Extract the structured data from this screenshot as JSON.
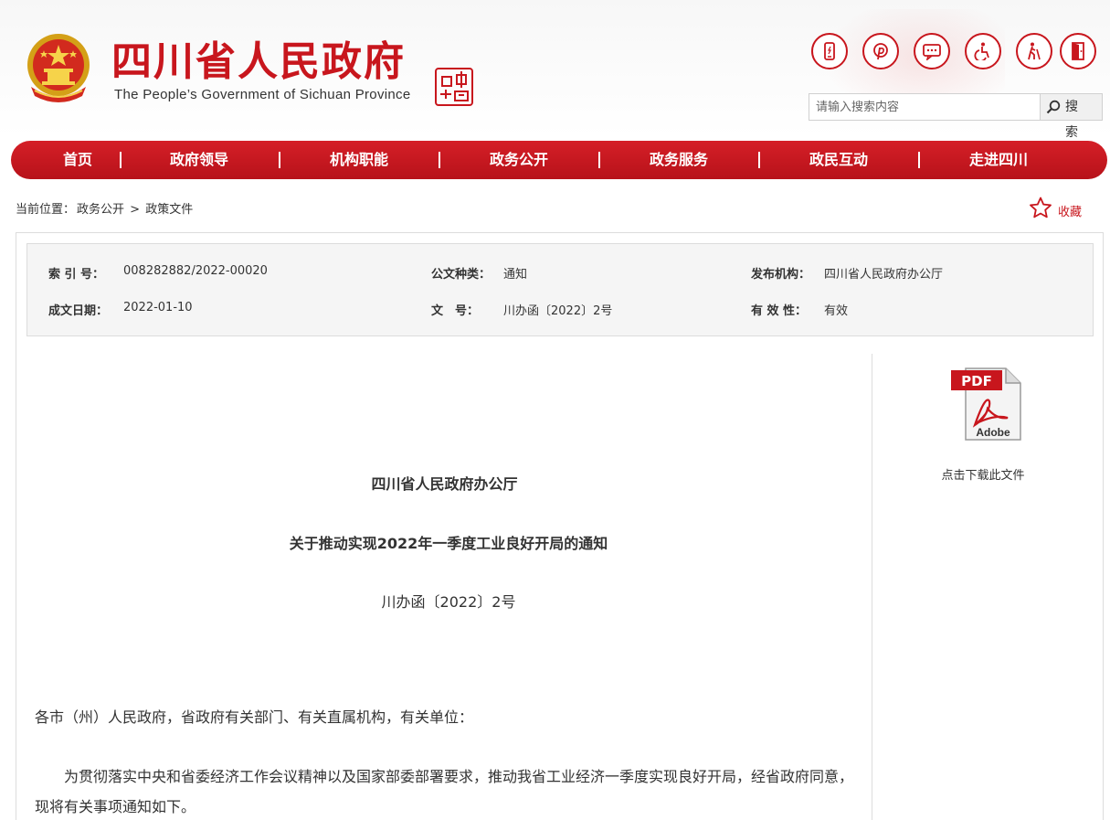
{
  "header": {
    "title": "四川省人民政府",
    "subtitle": "The People’s Government of Sichuan Province",
    "tools": [
      "mobile-icon",
      "pinterest-icon",
      "message-icon",
      "accessibility-icon",
      "elderly-icon",
      "exit-icon"
    ],
    "search_placeholder": "请输入搜索内容",
    "search_button": "搜 索"
  },
  "nav": {
    "items": [
      "首页",
      "政府领导",
      "机构职能",
      "政务公开",
      "政务服务",
      "政民互动",
      "走进四川"
    ]
  },
  "breadcrumb": {
    "prefix": "当前位置：",
    "level1": "政务公开",
    "sep": ">",
    "level2": "政策文件"
  },
  "favorite": {
    "label": "收藏"
  },
  "meta": {
    "index_label": "索 引 号：",
    "index_value": "008282882/2022-00020",
    "type_label": "公文种类：",
    "type_value": "通知",
    "org_label": "发布机构：",
    "org_value": "四川省人民政府办公厅",
    "date_label": "成文日期：",
    "date_value": "2022-01-10",
    "docno_label": "文　号：",
    "docno_value": "川办函〔2022〕2号",
    "validity_label": "有 效 性：",
    "validity_value": "有效"
  },
  "document": {
    "issuer": "四川省人民政府办公厅",
    "title": "关于推动实现2022年一季度工业良好开局的通知",
    "number": "川办函〔2022〕2号",
    "salutation": "各市（州）人民政府，省政府有关部门、有关直属机构，有关单位：",
    "paragraph1": "为贯彻落实中央和省委经济工作会议精神以及国家部委部署要求，推动我省工业经济一季度实现良好开局，经省政府同意，现将有关事项通知如下。"
  },
  "download": {
    "label": "点击下载此文件",
    "pdf_text": "PDF",
    "adobe_text": "Adobe"
  },
  "colors": {
    "brand_red": "#c8161d",
    "nav_red": "#c8161d"
  }
}
